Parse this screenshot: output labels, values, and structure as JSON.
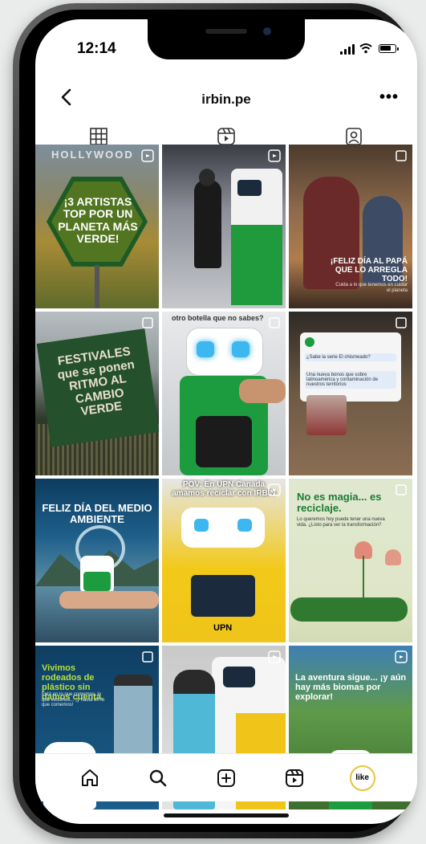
{
  "status": {
    "time": "12:14"
  },
  "header": {
    "username": "irbin.pe"
  },
  "tabs": [
    {
      "name": "grid",
      "icon": "grid-icon"
    },
    {
      "name": "reels",
      "icon": "reels-icon"
    },
    {
      "name": "tagged",
      "icon": "tagged-icon"
    }
  ],
  "posts": [
    {
      "text": "¡3 ARTISTAS TOP POR UN PLANETA MÁS VERDE!",
      "sub": "HOLLYWOOD",
      "type": "reel"
    },
    {
      "text": "",
      "sub": "",
      "type": "reel"
    },
    {
      "text": "¡FELIZ DÍA AL PAPÁ QUE LO ARREGLA TODO!",
      "sub": "Cuida a lo que tenemos en cuidar el planeta",
      "type": "post"
    },
    {
      "text": "FESTIVALES que se ponen RITMO AL CAMBIO VERDE",
      "sub": "",
      "type": "carousel"
    },
    {
      "text": "otro botella que no sabes?",
      "sub": "",
      "type": "carousel"
    },
    {
      "text": "¿Sabe la serie El chismeado?",
      "sub": "Una nueva bonos que sobre latinoamérica y contaminación de nuestros territorios",
      "type": "carousel"
    },
    {
      "text": "FELIZ DÍA DEL MEDIO AMBIENTE",
      "sub": "",
      "type": "post"
    },
    {
      "text": "POV: En UPN Canada amamos reciclar con IRBIN",
      "sub": "UPN",
      "type": "reel"
    },
    {
      "text": "No es magia... es reciclaje.",
      "sub": "Lo queremos hoy puede tener una nueva vida. ¿Listo para ver la transformación?",
      "type": "carousel"
    },
    {
      "text": "Vivimos rodeados de plástico sin damos cuenta.",
      "sub": "Está en lo que comemos, lo que vestimos... ¡y hasta en lo que comemos!",
      "type": "carousel"
    },
    {
      "text": "",
      "sub": "",
      "type": "reel"
    },
    {
      "text": "La aventura sigue... ¡y aún hay más biomas por explorar!",
      "sub": "",
      "type": "reel"
    }
  ],
  "nav": {
    "items": [
      {
        "icon": "home-icon"
      },
      {
        "icon": "search-icon"
      },
      {
        "icon": "create-icon"
      },
      {
        "icon": "reels-icon"
      }
    ],
    "avatar_label": "like"
  }
}
